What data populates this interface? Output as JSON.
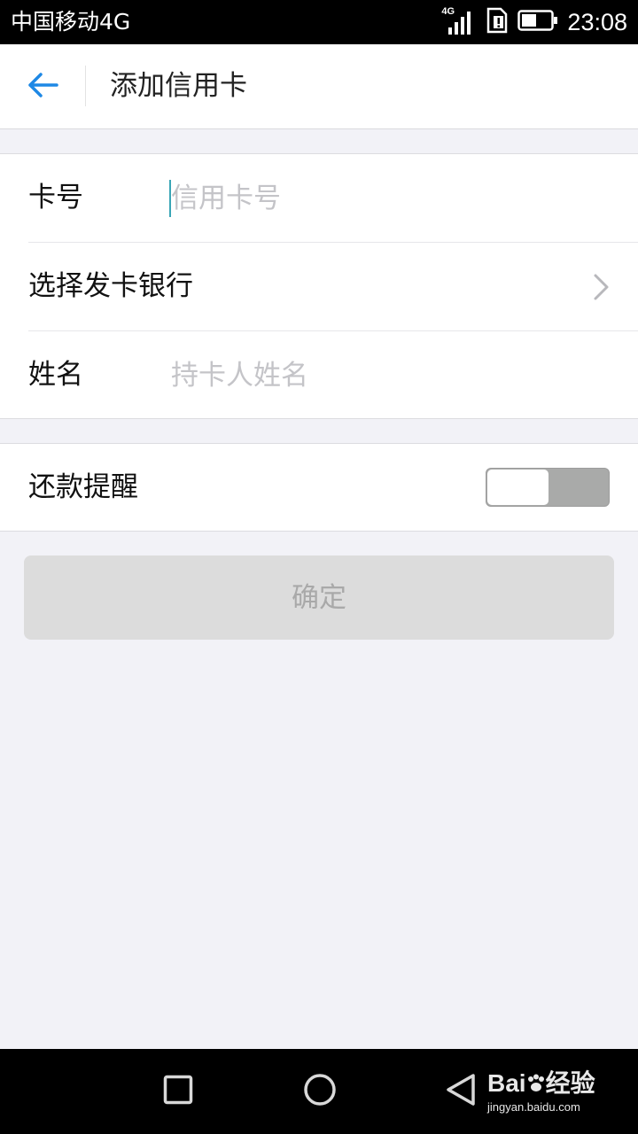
{
  "status_bar": {
    "carrier": "中国移动4G",
    "network_badge": "4G",
    "time": "23:08",
    "battery_percent": 50
  },
  "nav": {
    "title": "添加信用卡",
    "back_icon": "arrow-left-icon"
  },
  "form": {
    "card_number": {
      "label": "卡号",
      "placeholder": "信用卡号",
      "value": ""
    },
    "bank": {
      "label": "选择发卡银行"
    },
    "name": {
      "label": "姓名",
      "placeholder": "持卡人姓名",
      "value": ""
    }
  },
  "reminder": {
    "label": "还款提醒",
    "enabled": false
  },
  "confirm": {
    "label": "确定"
  },
  "watermark": {
    "brand": "Bai",
    "brand_suffix": "经验",
    "url": "jingyan.baidu.com"
  },
  "colors": {
    "accent": "#1e88e5",
    "background": "#f2f2f7",
    "disabled_button": "#dcdcdc"
  }
}
